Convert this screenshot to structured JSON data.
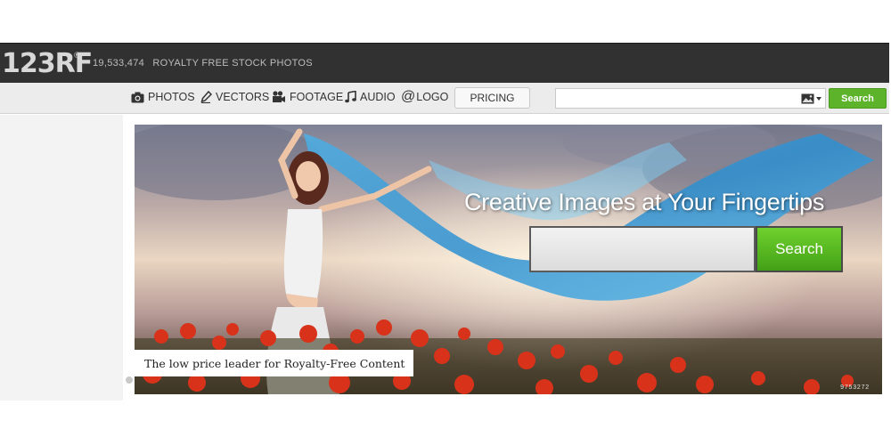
{
  "brand": {
    "logo": "123RF",
    "registered": "®"
  },
  "header": {
    "photo_count": "19,533,474",
    "photo_count_label": "ROYALTY FREE STOCK PHOTOS"
  },
  "nav": {
    "items": [
      {
        "label": "PHOTOS",
        "icon": "camera-icon"
      },
      {
        "label": "VECTORS",
        "icon": "pen-icon"
      },
      {
        "label": "FOOTAGE",
        "icon": "film-camera-icon"
      },
      {
        "label": "AUDIO",
        "icon": "music-note-icon"
      },
      {
        "label": "LOGO",
        "icon": "at-icon"
      }
    ],
    "logo_at": "@",
    "pricing_label": "PRICING",
    "search_placeholder": "",
    "search_type_icon": "image-icon",
    "search_button": "Search"
  },
  "hero": {
    "title": "Creative Images at Your Fingertips",
    "search_placeholder": "",
    "search_button": "Search",
    "tagline": "The low price leader for Royalty-Free Content",
    "image_id": "9753272"
  },
  "colors": {
    "topbar": "#313131",
    "search_green": "#5db32a",
    "navbar": "#ececec"
  }
}
